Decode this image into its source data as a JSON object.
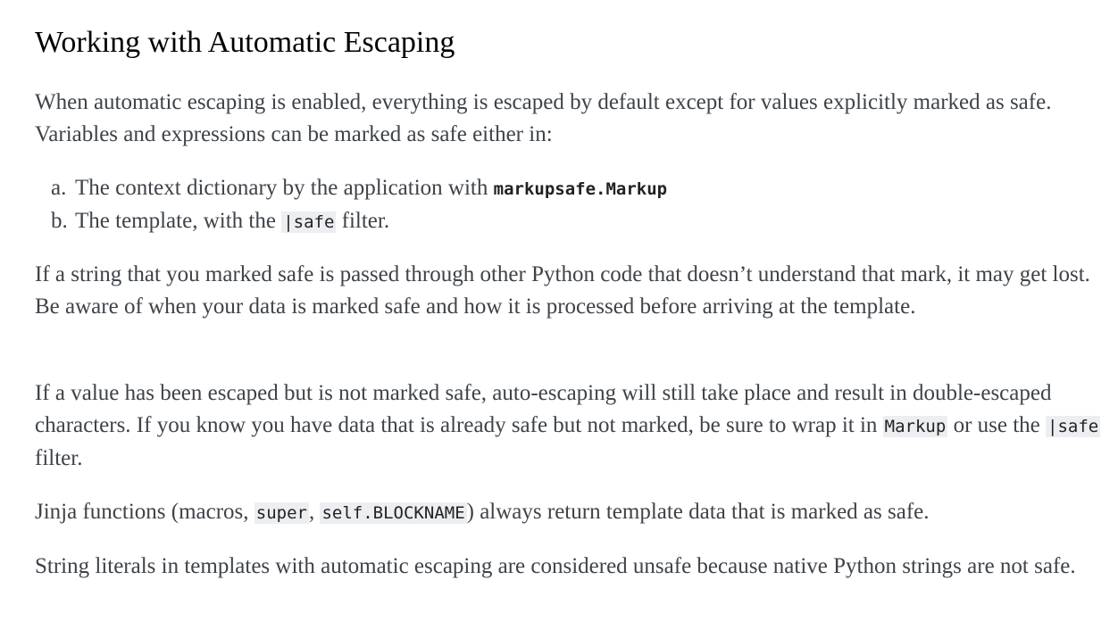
{
  "title": "Working with Automatic Escaping",
  "intro": {
    "text1": "When automatic escaping is enabled, everything is escaped by default except for values explicitly marked as safe. Variables and expressions can be marked as safe either in:"
  },
  "list": [
    {
      "marker": "a.",
      "text": "The context dictionary by the application with ",
      "code": "markupsafe.Markup",
      "after": ""
    },
    {
      "marker": "b.",
      "text": "The template, with the ",
      "code": "|safe",
      "after": " filter."
    }
  ],
  "para2": "If a string that you marked safe is passed through other Python code that doesn’t understand that mark, it may get lost. Be aware of when your data is marked safe and how it is processed before arriving at the template.",
  "para3": {
    "text1": "If a value has been escaped but is not marked safe, auto-escaping will still take place and result in double-escaped characters. If you know you have data that is already safe but not marked, be sure to wrap it in ",
    "code1": "Markup",
    "text2": " or use the ",
    "code2": "|safe",
    "text3": " filter."
  },
  "para4": {
    "text1": "Jinja functions (macros, ",
    "code1": "super",
    "text2": ", ",
    "code2": "self.BLOCKNAME",
    "text3": ") always return template data that is marked as safe."
  },
  "para5": "String literals in templates with automatic escaping are considered unsafe because native Python strings are not safe."
}
